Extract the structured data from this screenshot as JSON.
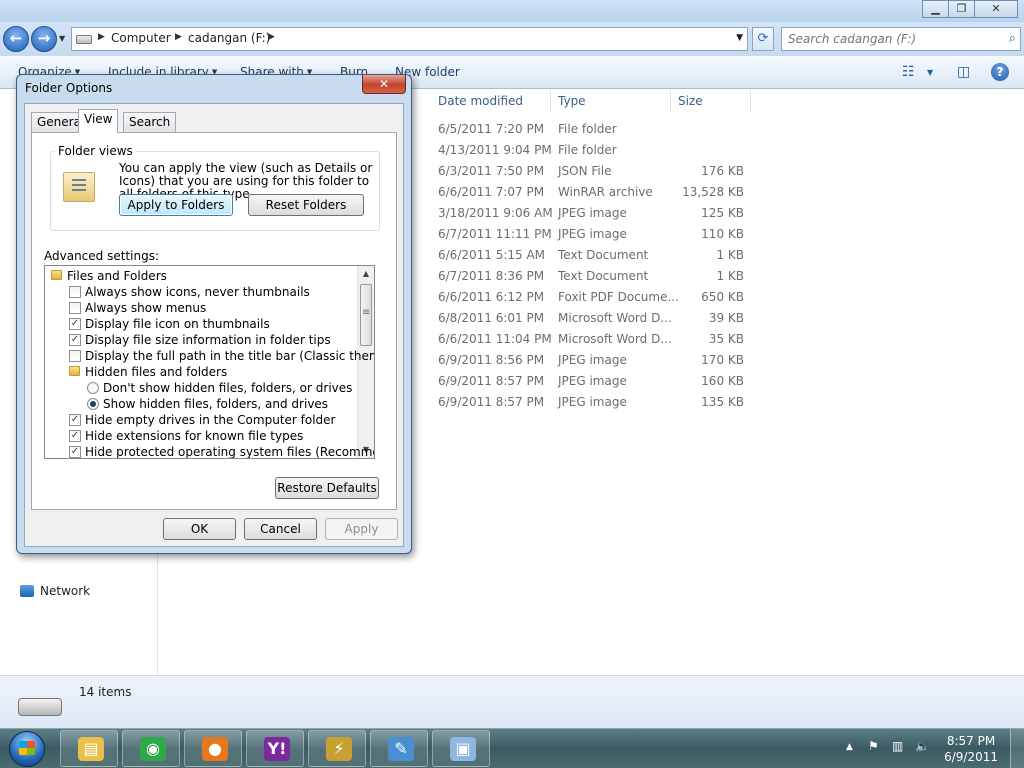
{
  "explorer": {
    "breadcrumbs": [
      "Computer",
      "cadangan (F:)"
    ],
    "search_placeholder": "Search cadangan (F:)",
    "toolbar": {
      "organize": "Organize",
      "include": "Include in library",
      "share": "Share with",
      "burn": "Burn",
      "new_folder": "New folder"
    },
    "columns": {
      "date": "Date modified",
      "type": "Type",
      "size": "Size"
    },
    "files": [
      {
        "date": "6/5/2011 7:20 PM",
        "type": "File folder",
        "size": ""
      },
      {
        "date": "4/13/2011 9:04 PM",
        "type": "File folder",
        "size": ""
      },
      {
        "date": "6/3/2011 7:50 PM",
        "type": "JSON File",
        "size": "176 KB"
      },
      {
        "date": "6/6/2011 7:07 PM",
        "type": "WinRAR archive",
        "size": "13,528 KB"
      },
      {
        "date": "3/18/2011 9:06 AM",
        "type": "JPEG image",
        "size": "125 KB"
      },
      {
        "date": "6/7/2011 11:11 PM",
        "type": "JPEG image",
        "size": "110 KB"
      },
      {
        "date": "6/6/2011 5:15 AM",
        "type": "Text Document",
        "size": "1 KB"
      },
      {
        "date": "6/7/2011 8:36 PM",
        "type": "Text Document",
        "size": "1 KB"
      },
      {
        "date": "6/6/2011 6:12 PM",
        "type": "Foxit PDF Docume...",
        "size": "650 KB"
      },
      {
        "date": "6/8/2011 6:01 PM",
        "type": "Microsoft Word D...",
        "size": "39 KB"
      },
      {
        "date": "6/6/2011 11:04 PM",
        "type": "Microsoft Word D...",
        "size": "35 KB"
      },
      {
        "date": "6/9/2011 8:56 PM",
        "type": "JPEG image",
        "size": "170 KB"
      },
      {
        "date": "6/9/2011 8:57 PM",
        "type": "JPEG image",
        "size": "160 KB"
      },
      {
        "date": "6/9/2011 8:57 PM",
        "type": "JPEG image",
        "size": "135 KB"
      }
    ],
    "nav_network": "Network",
    "status_count": "14 items"
  },
  "dialog": {
    "title": "Folder Options",
    "close_glyph": "✕",
    "tabs": [
      "General",
      "View",
      "Search"
    ],
    "folder_views": {
      "legend": "Folder views",
      "text": "You can apply the view (such as Details or Icons) that you are using for this folder to all folders of this type.",
      "apply_button": "Apply to Folders",
      "reset_button": "Reset Folders"
    },
    "advanced_label": "Advanced settings:",
    "tree": [
      {
        "kind": "folder",
        "indent": 0,
        "label": "Files and Folders"
      },
      {
        "kind": "check",
        "indent": 1,
        "checked": false,
        "label": "Always show icons, never thumbnails"
      },
      {
        "kind": "check",
        "indent": 1,
        "checked": false,
        "label": "Always show menus"
      },
      {
        "kind": "check",
        "indent": 1,
        "checked": true,
        "label": "Display file icon on thumbnails"
      },
      {
        "kind": "check",
        "indent": 1,
        "checked": true,
        "label": "Display file size information in folder tips"
      },
      {
        "kind": "check",
        "indent": 1,
        "checked": false,
        "label": "Display the full path in the title bar (Classic theme only)"
      },
      {
        "kind": "folder",
        "indent": 1,
        "label": "Hidden files and folders"
      },
      {
        "kind": "radio",
        "indent": 2,
        "checked": false,
        "label": "Don't show hidden files, folders, or drives"
      },
      {
        "kind": "radio",
        "indent": 2,
        "checked": true,
        "label": "Show hidden files, folders, and drives"
      },
      {
        "kind": "check",
        "indent": 1,
        "checked": true,
        "label": "Hide empty drives in the Computer folder"
      },
      {
        "kind": "check",
        "indent": 1,
        "checked": true,
        "label": "Hide extensions for known file types"
      },
      {
        "kind": "check",
        "indent": 1,
        "checked": true,
        "label": "Hide protected operating system files (Recommended)"
      }
    ],
    "restore_button": "Restore Defaults",
    "ok_button": "OK",
    "cancel_button": "Cancel",
    "apply_button": "Apply"
  },
  "taskbar": {
    "apps": [
      {
        "name": "windows-explorer",
        "icon": "folder-icon",
        "color": "#e8c04a",
        "glyph": "▤"
      },
      {
        "name": "green-app",
        "icon": "green-app-icon",
        "color": "#2fa84a",
        "glyph": "◉"
      },
      {
        "name": "firefox",
        "icon": "firefox-icon",
        "color": "#e8761c",
        "glyph": "●"
      },
      {
        "name": "yahoo-messenger",
        "icon": "yahoo-messenger-icon",
        "color": "#7b2a9b",
        "glyph": "Y!"
      },
      {
        "name": "winamp",
        "icon": "winamp-icon",
        "color": "#c8a032",
        "glyph": "⚡"
      },
      {
        "name": "paint",
        "icon": "paint-icon",
        "color": "#4a8fd0",
        "glyph": "✎"
      },
      {
        "name": "folder-options",
        "icon": "folder-options-icon",
        "color": "#8fb8e0",
        "glyph": "▣"
      }
    ],
    "clock_time": "8:57 PM",
    "clock_date": "6/9/2011"
  },
  "colors": {
    "accent": "#3399ff",
    "taskbar": "#3b5a63",
    "dialog_frame": "#c9dcef",
    "close_red": "#c2432c"
  }
}
